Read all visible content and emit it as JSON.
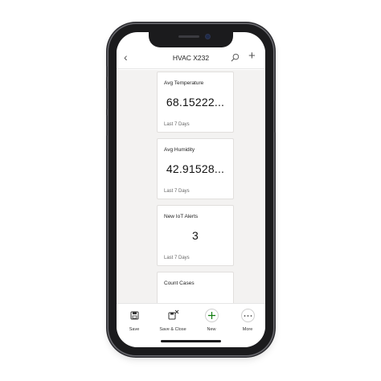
{
  "header": {
    "title": "HVAC X232",
    "back_icon": "chevron-left-icon",
    "search_icon": "search-icon",
    "add_icon": "plus-icon"
  },
  "cards": [
    {
      "title": "Avg Temperature",
      "value": "68.15222...",
      "period": "Last 7 Days"
    },
    {
      "title": "Avg Humidity",
      "value": "42.91528...",
      "period": "Last 7 Days"
    },
    {
      "title": "New IoT Alerts",
      "value": "3",
      "period": "Last 7 Days"
    },
    {
      "title": "Count Cases",
      "value": "",
      "period": ""
    }
  ],
  "toolbar": {
    "save_label": "Save",
    "save_close_label": "Save & Close",
    "new_label": "New",
    "more_label": "More"
  },
  "colors": {
    "accent_green": "#107c10",
    "background": "#f3f2f1"
  }
}
